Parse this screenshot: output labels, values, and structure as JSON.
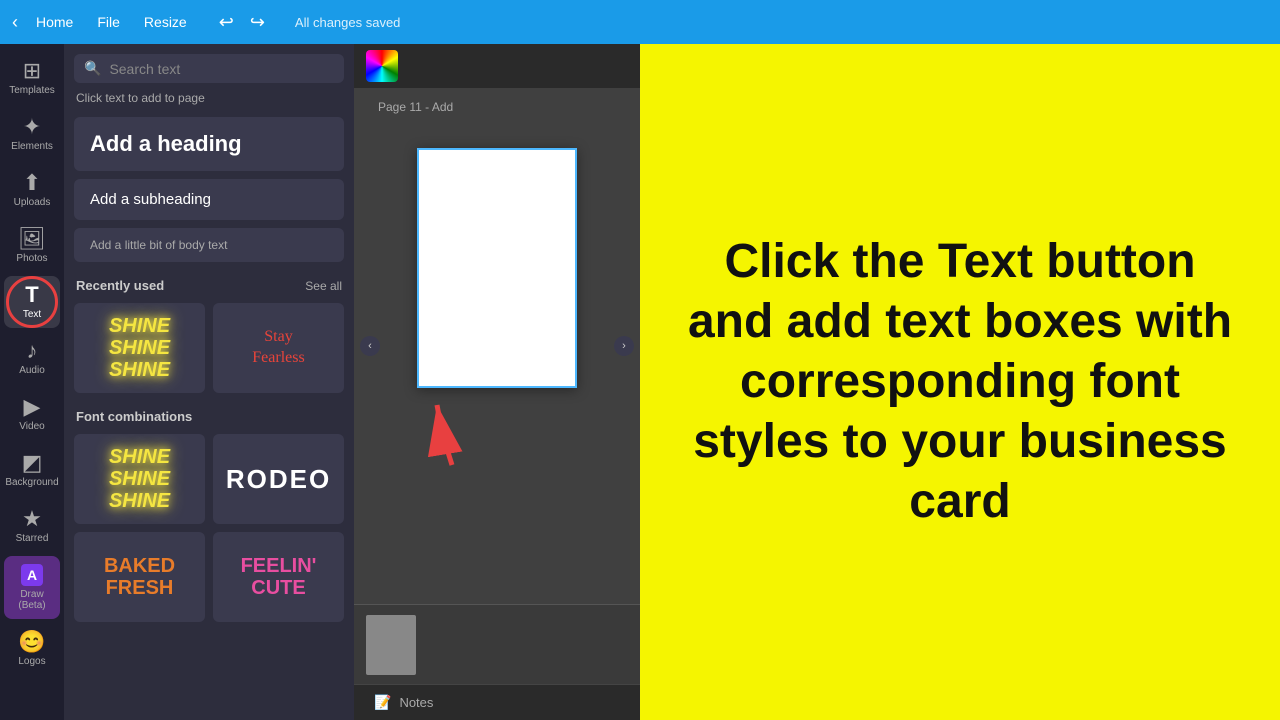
{
  "topbar": {
    "home_label": "Home",
    "file_label": "File",
    "resize_label": "Resize",
    "undo_label": "↩",
    "redo_label": "↪",
    "status": "All changes saved"
  },
  "sidebar": {
    "items": [
      {
        "id": "templates",
        "label": "Templates",
        "icon": "⊞"
      },
      {
        "id": "elements",
        "label": "Elements",
        "icon": "✦"
      },
      {
        "id": "uploads",
        "label": "Uploads",
        "icon": "⬆"
      },
      {
        "id": "photos",
        "label": "Photos",
        "icon": "🖼"
      },
      {
        "id": "text",
        "label": "Text",
        "icon": "T",
        "active": true
      },
      {
        "id": "audio",
        "label": "Audio",
        "icon": "♪"
      },
      {
        "id": "video",
        "label": "Video",
        "icon": "▶"
      },
      {
        "id": "background",
        "label": "Background",
        "icon": "◩"
      },
      {
        "id": "starred",
        "label": "Starred",
        "icon": "★"
      },
      {
        "id": "draw",
        "label": "Draw (Beta)",
        "icon": "A"
      },
      {
        "id": "logos",
        "label": "Logos",
        "icon": "😊"
      }
    ]
  },
  "text_panel": {
    "search_placeholder": "Search text",
    "click_label": "Click text to add to page",
    "add_heading": "Add a heading",
    "add_subheading": "Add a subheading",
    "add_body": "Add a little bit of body text",
    "recently_used_label": "Recently used",
    "see_all_label": "See all",
    "font_combinations_label": "Font combinations",
    "fonts": [
      {
        "id": "shine1",
        "type": "shine",
        "text": "SHINE\nSHINE\nSHINE"
      },
      {
        "id": "stay_fearless",
        "type": "script",
        "text": "Stay\nFearless"
      },
      {
        "id": "shine2",
        "type": "shine",
        "text": "SHINE\nSHINE\nSHINE"
      },
      {
        "id": "rodeo",
        "type": "rodeo",
        "text": "RODEO"
      },
      {
        "id": "baked_fresh",
        "type": "baked",
        "text": "BAKED\nFRESH"
      },
      {
        "id": "feelin_cute",
        "type": "cute",
        "text": "FEELIN'\nCUTE"
      }
    ]
  },
  "canvas": {
    "page_label": "Page 11 - Add",
    "notes_label": "Notes"
  },
  "right_panel": {
    "instruction": "Click the Text button and add text boxes with corresponding font styles to your business card"
  }
}
